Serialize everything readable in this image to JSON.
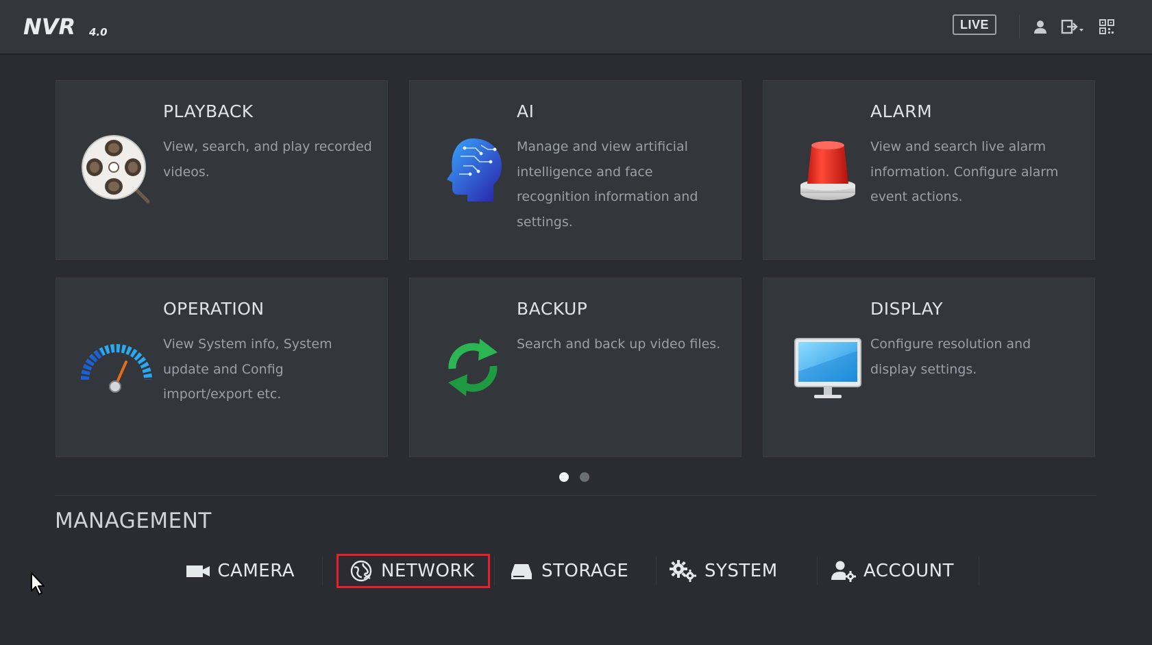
{
  "header": {
    "logo_text": "NVR",
    "logo_version": "4.0",
    "live_label": "LIVE",
    "icons": [
      "user-icon",
      "logout-icon",
      "qr-code-icon"
    ]
  },
  "cards": [
    {
      "title": "PLAYBACK",
      "desc": "View, search, and play recorded videos.",
      "icon": "film-reel-icon"
    },
    {
      "title": "AI",
      "desc": "Manage and view artificial intelligence and face recognition information and settings.",
      "icon": "ai-brain-head-icon"
    },
    {
      "title": "ALARM",
      "desc": "View and search live alarm information. Configure alarm event actions.",
      "icon": "alarm-siren-icon"
    },
    {
      "title": "OPERATION",
      "desc": "View System info, System update and Config import/export etc.",
      "icon": "speedometer-icon"
    },
    {
      "title": "BACKUP",
      "desc": "Search and back up video files.",
      "icon": "backup-arrows-icon"
    },
    {
      "title": "DISPLAY",
      "desc": "Configure resolution and display settings.",
      "icon": "monitor-icon"
    }
  ],
  "pager": {
    "pages": 2,
    "current": 1
  },
  "management": {
    "title": "MANAGEMENT",
    "items": [
      {
        "label": "CAMERA",
        "icon": "camera-icon",
        "selected": false
      },
      {
        "label": "NETWORK",
        "icon": "network-globe-icon",
        "selected": true
      },
      {
        "label": "STORAGE",
        "icon": "storage-drive-icon",
        "selected": false
      },
      {
        "label": "SYSTEM",
        "icon": "gears-icon",
        "selected": false
      },
      {
        "label": "ACCOUNT",
        "icon": "account-settings-icon",
        "selected": false
      }
    ]
  },
  "colors": {
    "background": "#2a2c31",
    "card": "#33363b",
    "highlight": "#e8202a"
  }
}
